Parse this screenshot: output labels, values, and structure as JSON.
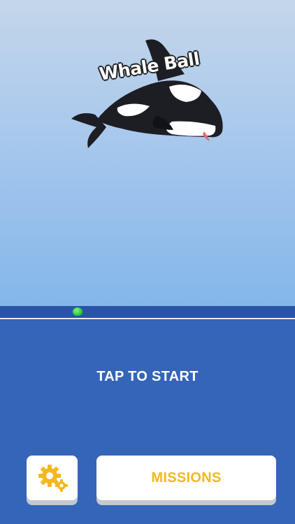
{
  "game": {
    "title": "Whale Ball",
    "start_prompt": "TAP TO START"
  },
  "buttons": {
    "settings_icon": "gear-icon",
    "missions_label": "MISSIONS"
  },
  "colors": {
    "sky_top": "#c4d6ea",
    "sky_bottom": "#84b6ea",
    "sea": "#3565b8",
    "ball": "#2ecc3c",
    "accent": "#f4b81e",
    "button_bg": "#ffffff"
  }
}
